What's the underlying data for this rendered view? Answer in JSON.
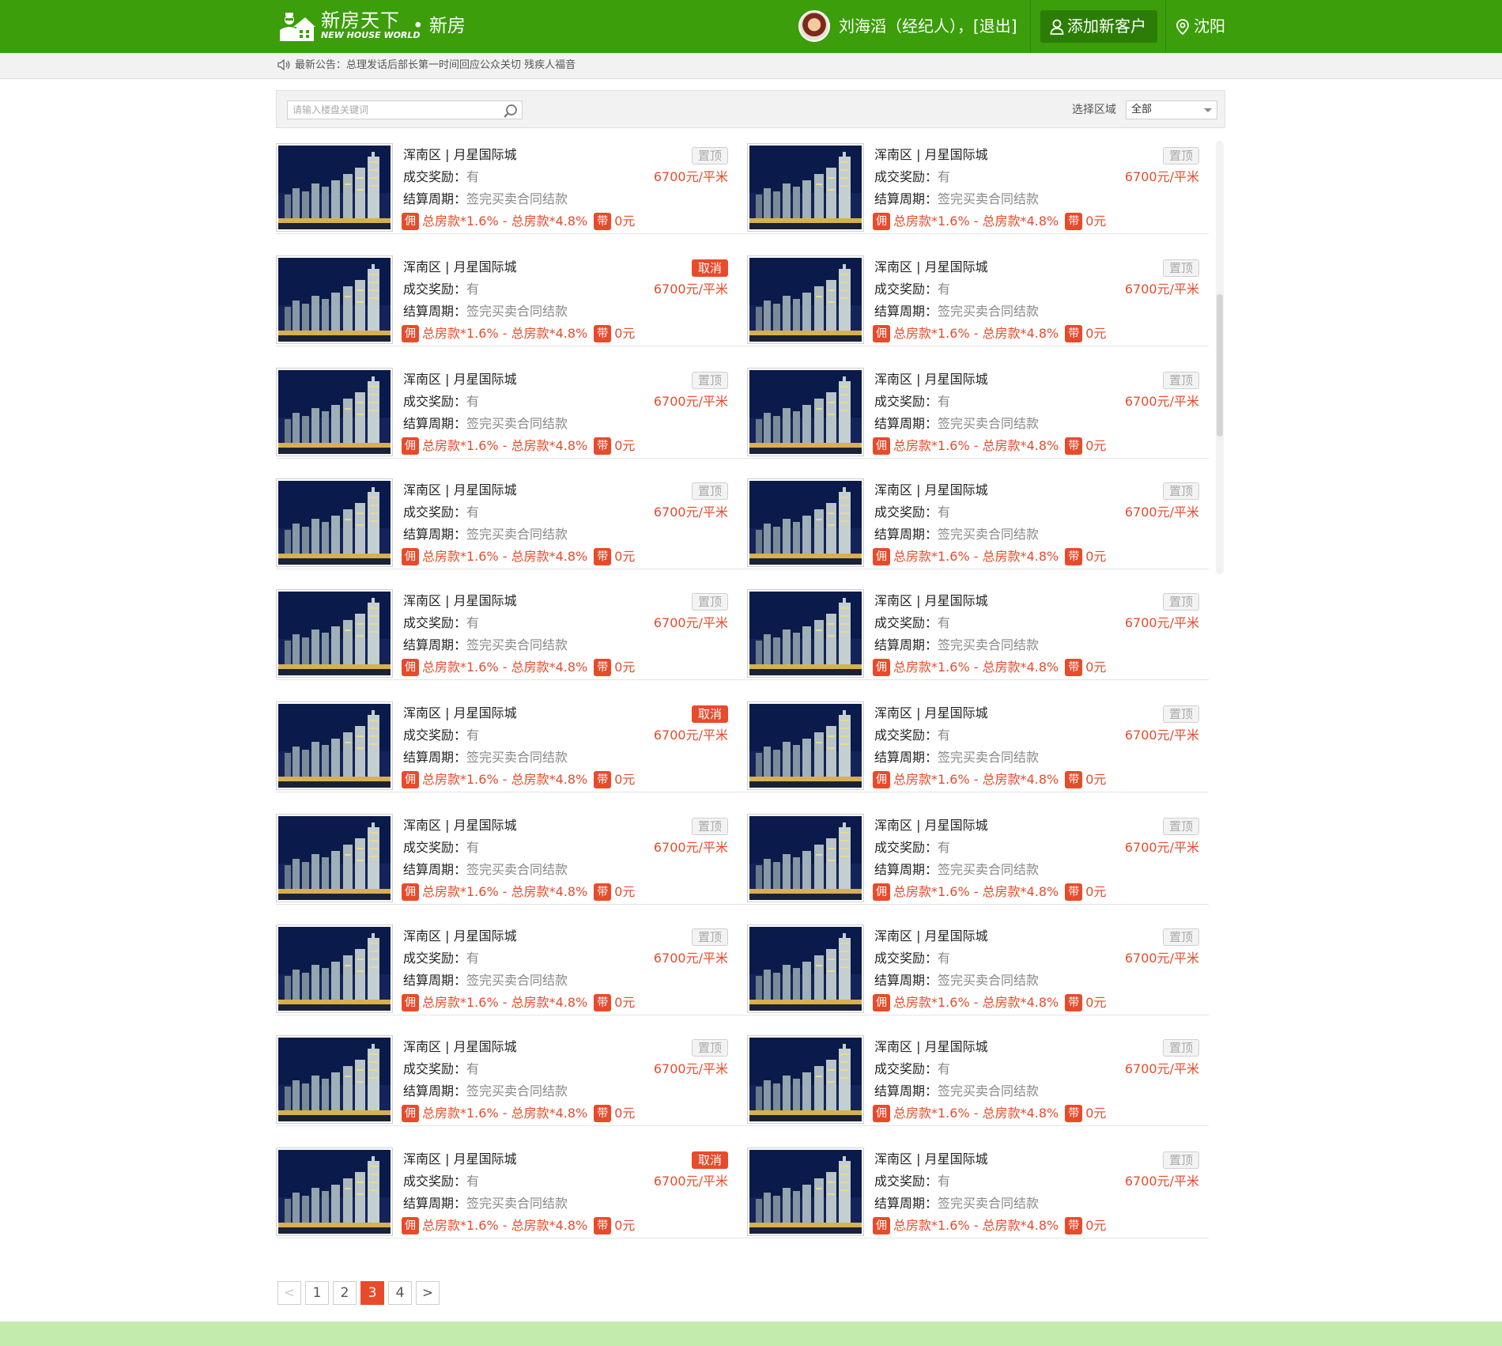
{
  "brand": {
    "name_cn": "新房天下",
    "name_en": "NEW HOUSE WORLD",
    "section": "• 新房",
    "color": "#3b9e0a"
  },
  "user": {
    "name": "刘海滔（经纪人）",
    "logout": "[退出]"
  },
  "add_client_label": "添加新客户",
  "city": "沈阳",
  "notice": {
    "text": "最新公告：总理发话后部长第一时间回应公众关切 残疾人福音"
  },
  "search": {
    "placeholder": "请输入楼盘关键词"
  },
  "region": {
    "label": "选择区域",
    "selected": "全部"
  },
  "listings": {
    "title": "浑南区 | 月星国际城",
    "reward_label": "成交奖励：",
    "reward_value": "有",
    "cycle_label": "结算周期：",
    "cycle_value": "签完买卖合同结款",
    "commission_tag": "佣",
    "commission": "总房款*1.6% - 总房款*4.8%",
    "bring_tag": "带",
    "bring_fee": "0元",
    "price": "6700元/平米",
    "pin_label": "置顶",
    "cancel_label": "取消"
  },
  "rows": [
    {
      "left_pin": "置顶",
      "right_pin": "置顶"
    },
    {
      "left_pin": "取消",
      "right_pin": "置顶"
    },
    {
      "left_pin": "置顶",
      "right_pin": "置顶"
    },
    {
      "left_pin": "置顶",
      "right_pin": "置顶"
    },
    {
      "left_pin": "置顶",
      "right_pin": "置顶"
    },
    {
      "left_pin": "取消",
      "right_pin": "置顶"
    },
    {
      "left_pin": "置顶",
      "right_pin": "置顶"
    },
    {
      "left_pin": "置顶",
      "right_pin": "置顶"
    },
    {
      "left_pin": "置顶",
      "right_pin": "置顶"
    },
    {
      "left_pin": "取消",
      "right_pin": "置顶"
    }
  ],
  "pagination": {
    "prev": "<",
    "next": ">",
    "pages": [
      "1",
      "2",
      "3",
      "4"
    ],
    "current": "3"
  },
  "colors": {
    "accent": "#e84b2b",
    "footer": "#c4ebae"
  }
}
